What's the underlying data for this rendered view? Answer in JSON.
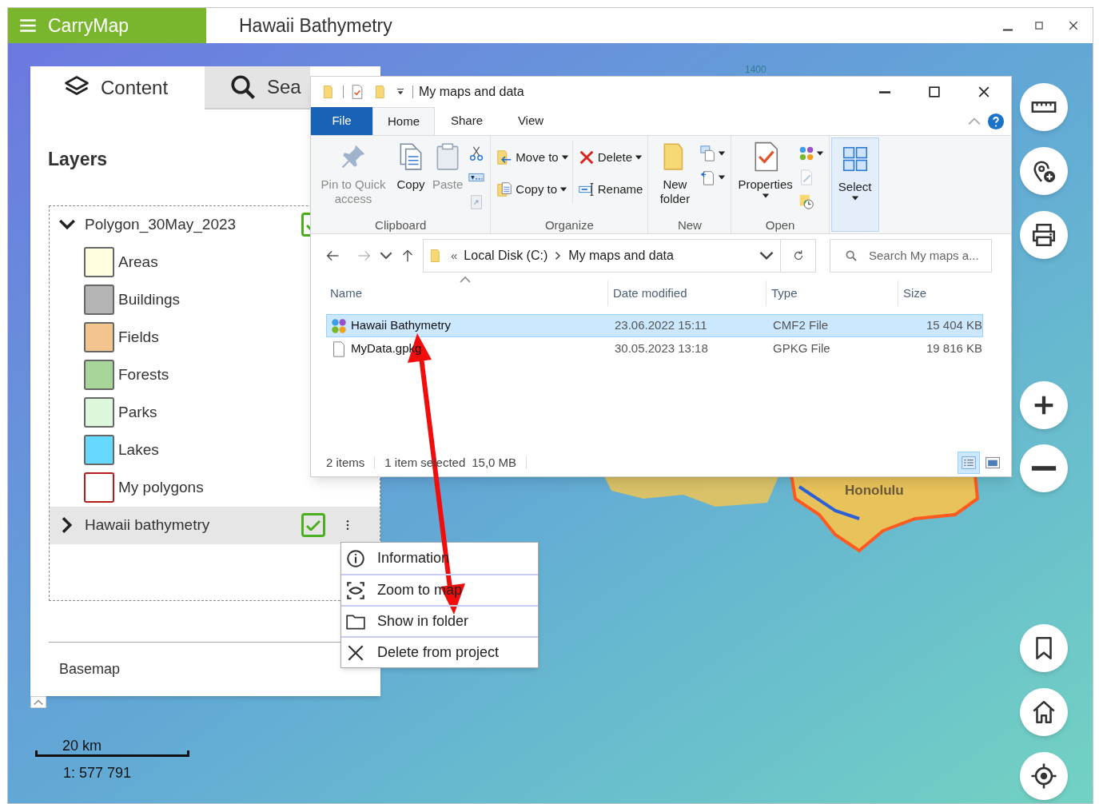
{
  "app": {
    "name": "CarryMap",
    "title": "Hawaii Bathymetry"
  },
  "panel": {
    "tabs": [
      {
        "label": "Content",
        "kind": "layers",
        "selected": true
      },
      {
        "label": "Sea",
        "kind": "search",
        "selected": false
      }
    ],
    "heading": "Layers",
    "layers": [
      {
        "name": "Polygon_30May_2023",
        "expanded": true,
        "checked": true,
        "selected": false,
        "children": [
          {
            "name": "Areas",
            "color": "#ffffe0"
          },
          {
            "name": "Buildings",
            "color": "#b4b4b4"
          },
          {
            "name": "Fields",
            "color": "#f2c58e"
          },
          {
            "name": "Forests",
            "color": "#a8d59a"
          },
          {
            "name": "Parks",
            "color": "#dcf7dc"
          },
          {
            "name": "Lakes",
            "color": "#66d9ff"
          },
          {
            "name": "My polygons",
            "color": "#ffffff"
          }
        ]
      },
      {
        "name": "Hawaii bathymetry",
        "expanded": false,
        "checked": true,
        "selected": true
      }
    ],
    "basemap": "Basemap"
  },
  "context_menu": [
    {
      "kind": "info",
      "label": "Information"
    },
    {
      "kind": "zoom",
      "label": "Zoom to map"
    },
    {
      "kind": "folder",
      "label": "Show in folder"
    },
    {
      "kind": "delete",
      "label": "Delete from project"
    }
  ],
  "explorer": {
    "title": "My maps and data",
    "tabs": [
      {
        "label": "File",
        "kind": "file",
        "selected": false
      },
      {
        "label": "Home",
        "kind": "tab",
        "selected": true
      },
      {
        "label": "Share",
        "kind": "tab",
        "selected": false
      },
      {
        "label": "View",
        "kind": "tab",
        "selected": false
      }
    ],
    "ribbon_groups": [
      {
        "label": "Clipboard",
        "highlighted": false,
        "columns": [
          [
            {
              "kind": "pin",
              "label": "Pin to Quick access",
              "disabled": true,
              "dropdown": false
            }
          ],
          [
            {
              "kind": "copy",
              "label": "Copy",
              "disabled": false,
              "dropdown": false
            }
          ],
          [
            {
              "kind": "paste",
              "label": "Paste",
              "disabled": true,
              "dropdown": false
            }
          ],
          [
            {
              "kind": "cut",
              "disabled": false,
              "dropdown": false
            },
            {
              "kind": "copypath",
              "disabled": false,
              "dropdown": false
            },
            {
              "kind": "pasteshortcut",
              "disabled": true,
              "dropdown": false
            }
          ]
        ]
      },
      {
        "label": "Organize",
        "highlighted": false,
        "columns": [
          [
            {
              "kind": "move",
              "label": "Move to",
              "disabled": false,
              "dropdown": true
            },
            {
              "kind": "copyto",
              "label": "Copy to",
              "disabled": false,
              "dropdown": true
            }
          ],
          [
            {
              "kind": "delete",
              "label": "Delete",
              "disabled": false,
              "dropdown": true
            },
            {
              "kind": "rename",
              "label": "Rename",
              "disabled": false,
              "dropdown": false
            }
          ]
        ]
      },
      {
        "label": "New",
        "highlighted": false,
        "columns": [
          [
            {
              "kind": "newfolder",
              "label": "New folder",
              "disabled": false,
              "dropdown": false
            }
          ],
          [
            {
              "kind": "newitem",
              "disabled": false,
              "dropdown": true
            },
            {
              "kind": "easyaccess",
              "disabled": false,
              "dropdown": true
            }
          ]
        ]
      },
      {
        "label": "Open",
        "highlighted": false,
        "columns": [
          [
            {
              "kind": "properties",
              "label": "Properties",
              "disabled": false,
              "dropdown": true
            }
          ],
          [
            {
              "kind": "openwith",
              "disabled": false,
              "dropdown": true
            },
            {
              "kind": "edit",
              "disabled": true,
              "dropdown": false
            },
            {
              "kind": "history",
              "disabled": false,
              "dropdown": false
            }
          ]
        ]
      },
      {
        "highlighted": true,
        "columns": [
          [
            {
              "kind": "select",
              "label": "Select",
              "disabled": false,
              "dropdown": true
            }
          ]
        ]
      }
    ],
    "path_overflow": "«",
    "path": [
      "Local Disk (C:)",
      "My maps and data"
    ],
    "search": {
      "placeholder": "Search My maps a..."
    },
    "columns": [
      "Name",
      "Date modified",
      "Type",
      "Size"
    ],
    "rows": [
      {
        "kind": "map",
        "name": "Hawaii Bathymetry",
        "date": "23.06.2022 15:11",
        "type": "CMF2 File",
        "size": "15 404 KB",
        "selected": true
      },
      {
        "kind": "doc",
        "name": "MyData.gpkg",
        "date": "30.05.2023 13:18",
        "type": "GPKG File",
        "size": "19 816 KB",
        "selected": false
      }
    ],
    "status": [
      "2 items",
      "1 item selected",
      "15,0 MB"
    ]
  },
  "map": {
    "labels": [
      "Honolulu",
      "1400"
    ],
    "scale": {
      "distance": "20 km",
      "ratio": "1: 577 791"
    },
    "buttons": [
      {
        "kind": "ruler"
      },
      {
        "kind": "addpin"
      },
      {
        "kind": "print"
      },
      {
        "kind": "zoomin"
      },
      {
        "kind": "zoomout"
      },
      {
        "kind": "bookmark"
      },
      {
        "kind": "home"
      },
      {
        "kind": "locate"
      }
    ]
  }
}
